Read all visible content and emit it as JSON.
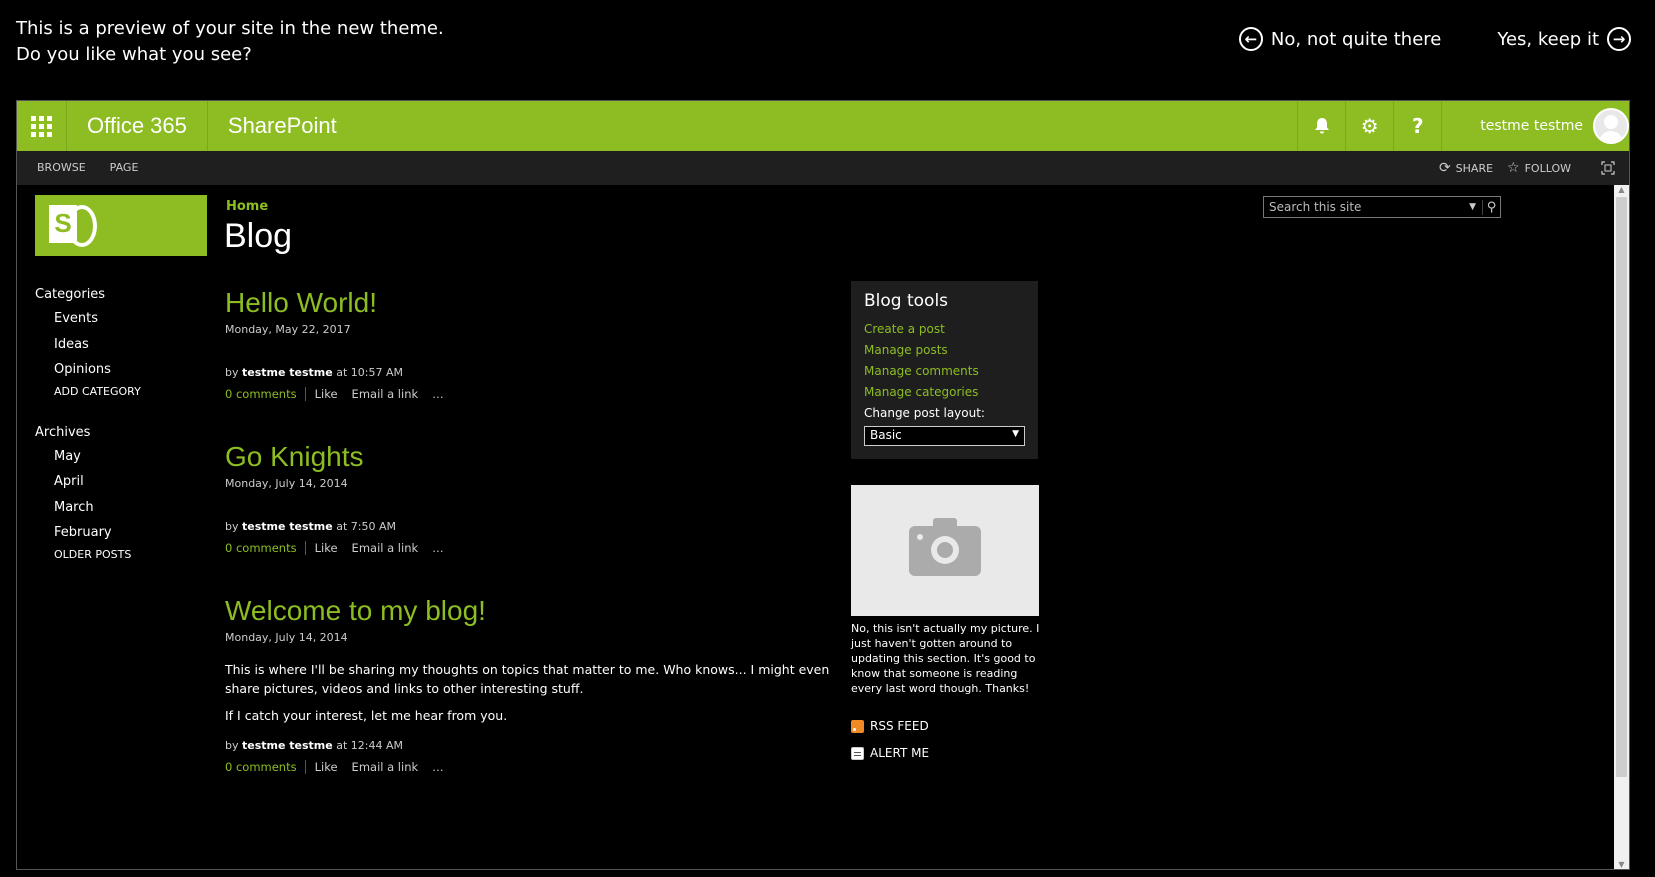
{
  "preview": {
    "line1": "This is a preview of your site in the new theme.",
    "line2": "Do you like what you see?",
    "reject_label": "No, not quite there",
    "accept_label": "Yes, keep it"
  },
  "suitebar": {
    "brand": "Office 365",
    "app": "SharePoint",
    "user": "testme testme"
  },
  "ribbon": {
    "tabs": [
      "BROWSE",
      "PAGE"
    ],
    "share": "SHARE",
    "follow": "FOLLOW"
  },
  "breadcrumb": "Home",
  "page_title": "Blog",
  "search": {
    "placeholder": "Search this site"
  },
  "leftnav": {
    "categories_title": "Categories",
    "categories": [
      "Events",
      "Ideas",
      "Opinions"
    ],
    "add_category": "ADD CATEGORY",
    "archives_title": "Archives",
    "archives": [
      "May",
      "April",
      "March",
      "February"
    ],
    "older_posts": "OLDER POSTS"
  },
  "posts": [
    {
      "title": "Hello World!",
      "date": "Monday, May 22, 2017",
      "body": [],
      "author": "testme testme",
      "time": "10:57 AM",
      "comments": "0 comments"
    },
    {
      "title": "Go Knights",
      "date": "Monday, July 14, 2014",
      "body": [],
      "author": "testme testme",
      "time": "7:50 AM",
      "comments": "0 comments"
    },
    {
      "title": "Welcome to my blog!",
      "date": "Monday, July 14, 2014",
      "body": [
        "This is where I'll be sharing my thoughts on topics that matter to me. Who knows... I might even share pictures, videos and links to other interesting stuff.",
        "If I catch your interest, let me hear from you."
      ],
      "author": "testme testme",
      "time": "12:44 AM",
      "comments": "0 comments"
    }
  ],
  "post_labels": {
    "by": "by",
    "at": "at",
    "like": "Like",
    "email": "Email a link",
    "more": "…"
  },
  "blog_tools": {
    "title": "Blog tools",
    "links": [
      "Create a post",
      "Manage posts",
      "Manage comments",
      "Manage categories"
    ],
    "layout_label": "Change post layout:",
    "layout_value": "Basic"
  },
  "photo_caption": "No, this isn't actually my picture. I just haven't gotten around to updating this section. It's good to know that someone is reading every last word though. Thanks!",
  "rss_label": "RSS FEED",
  "alert_label": "ALERT ME",
  "colors": {
    "accent": "#8dbd23",
    "background": "#000000"
  }
}
